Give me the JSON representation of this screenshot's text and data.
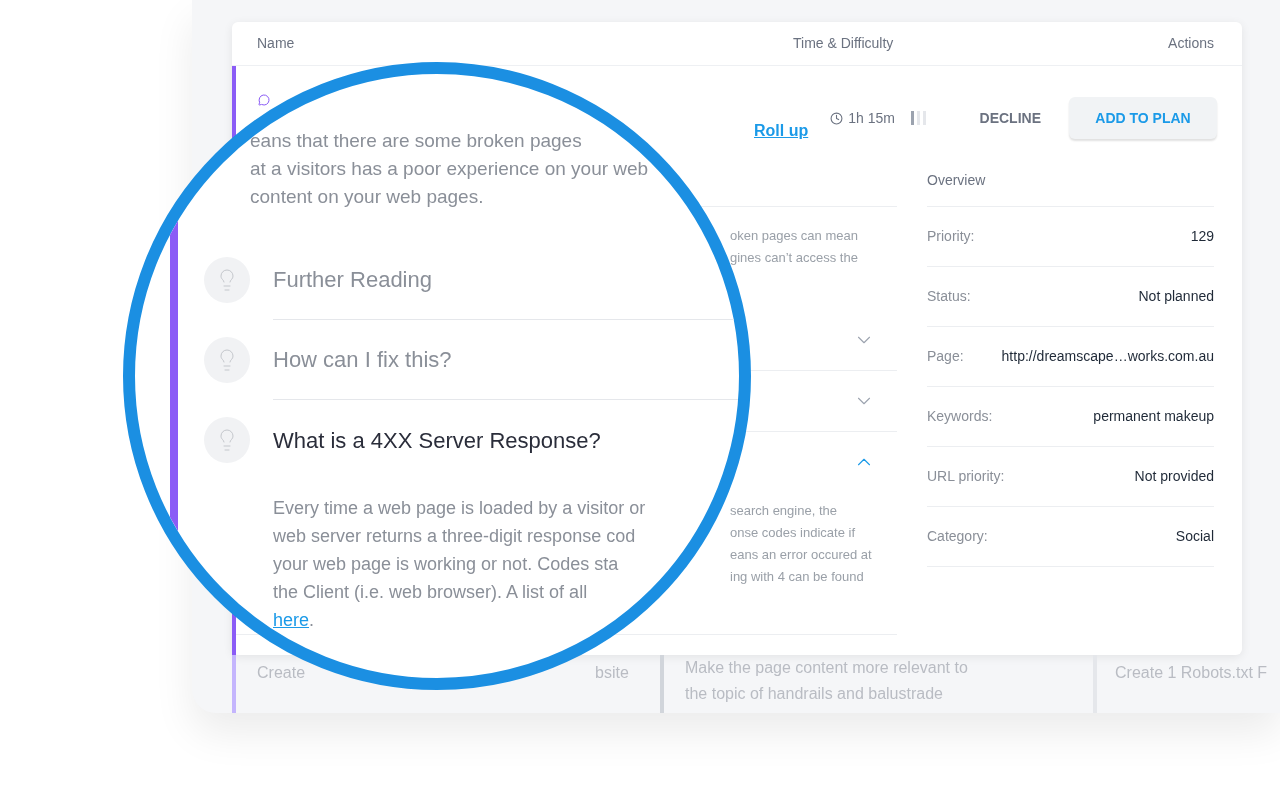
{
  "table": {
    "columns": [
      "Name",
      "Time & Difficulty",
      "Actions"
    ]
  },
  "task": {
    "roll_up_link": "Roll up",
    "time": "1h 15m",
    "difficulty": {
      "level": 0.34
    },
    "actions": {
      "decline": "DECLINE",
      "add_to_plan": "ADD TO PLAN"
    },
    "summary_lines": [
      "eans that there are some broken pages",
      "at a visitors has a poor experience on your web",
      "content on your web pages."
    ],
    "summary_fragment_lines": [
      "oken pages can mean",
      "gines can’t access the"
    ],
    "accordion": [
      {
        "title": "Further Reading",
        "expanded": false
      },
      {
        "title": "How can I fix this?",
        "expanded": false
      },
      {
        "title": "What is a 4XX Server Response?",
        "expanded": true,
        "body_lines": [
          "Every time a web page is loaded by a visitor or",
          "web server returns a three-digit response cod",
          "your web page is working or not. Codes sta",
          "the Client (i.e. web browser). A list of all"
        ],
        "body_link": "here",
        "body_tail": ".",
        "body_fragment_lines": [
          "search engine, the",
          "onse codes indicate if",
          "eans an error occured at",
          "ing with 4 can be found"
        ]
      }
    ],
    "overview": {
      "title": "Overview",
      "rows": [
        {
          "label": "Priority:",
          "value": "129"
        },
        {
          "label": "Status:",
          "value": "Not planned"
        },
        {
          "label": "Page:",
          "value": "http://dreamscape…works.com.au"
        },
        {
          "label": "Keywords:",
          "value": "permanent makeup"
        },
        {
          "label": "URL priority:",
          "value": "Not provided"
        },
        {
          "label": "Category:",
          "value": "Social"
        }
      ]
    }
  },
  "row_below": {
    "column_1": [
      "Create",
      "bsite"
    ],
    "column_2": [
      "Make the page content more relevant to",
      "the topic of handrails and balustrade"
    ],
    "column_3": "Create 1 Robots.txt F"
  }
}
